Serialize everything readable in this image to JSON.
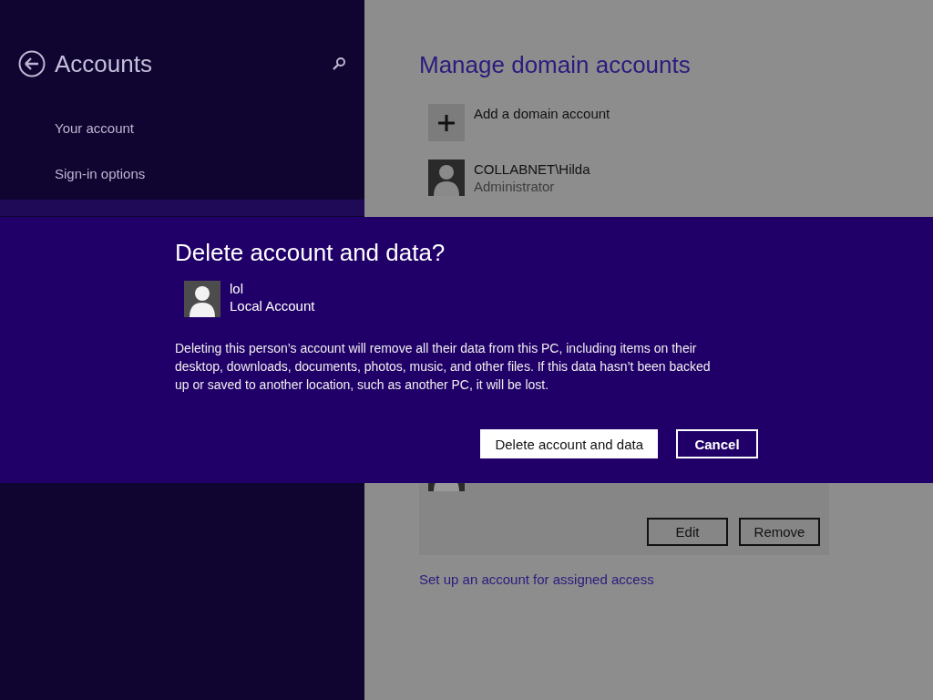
{
  "sidebar": {
    "title": "Accounts",
    "items": [
      {
        "label": "Your account",
        "selected": false
      },
      {
        "label": "Sign-in options",
        "selected": false
      }
    ]
  },
  "main": {
    "title": "Manage domain accounts",
    "accounts": [
      {
        "kind": "add",
        "name": "Add a domain account"
      },
      {
        "kind": "user",
        "name": "COLLABNET\\Hilda",
        "role": "Administrator"
      }
    ],
    "selected_account": {
      "buttons": [
        "Edit",
        "Remove"
      ]
    },
    "link": "Set up an account for assigned access"
  },
  "dialog": {
    "title": "Delete account and data?",
    "account": {
      "name": "lol",
      "type": "Local Account"
    },
    "message": "Deleting this person’s account will remove all their data from this PC, including items on their desktop, downloads, documents, photos, music, and other files. If this data hasn’t been backed up or saved to another location, such as another PC, it will be lost.",
    "buttons": [
      {
        "label": "Delete account and data",
        "kind": "primary"
      },
      {
        "label": "Cancel",
        "kind": "secondary"
      }
    ]
  }
}
